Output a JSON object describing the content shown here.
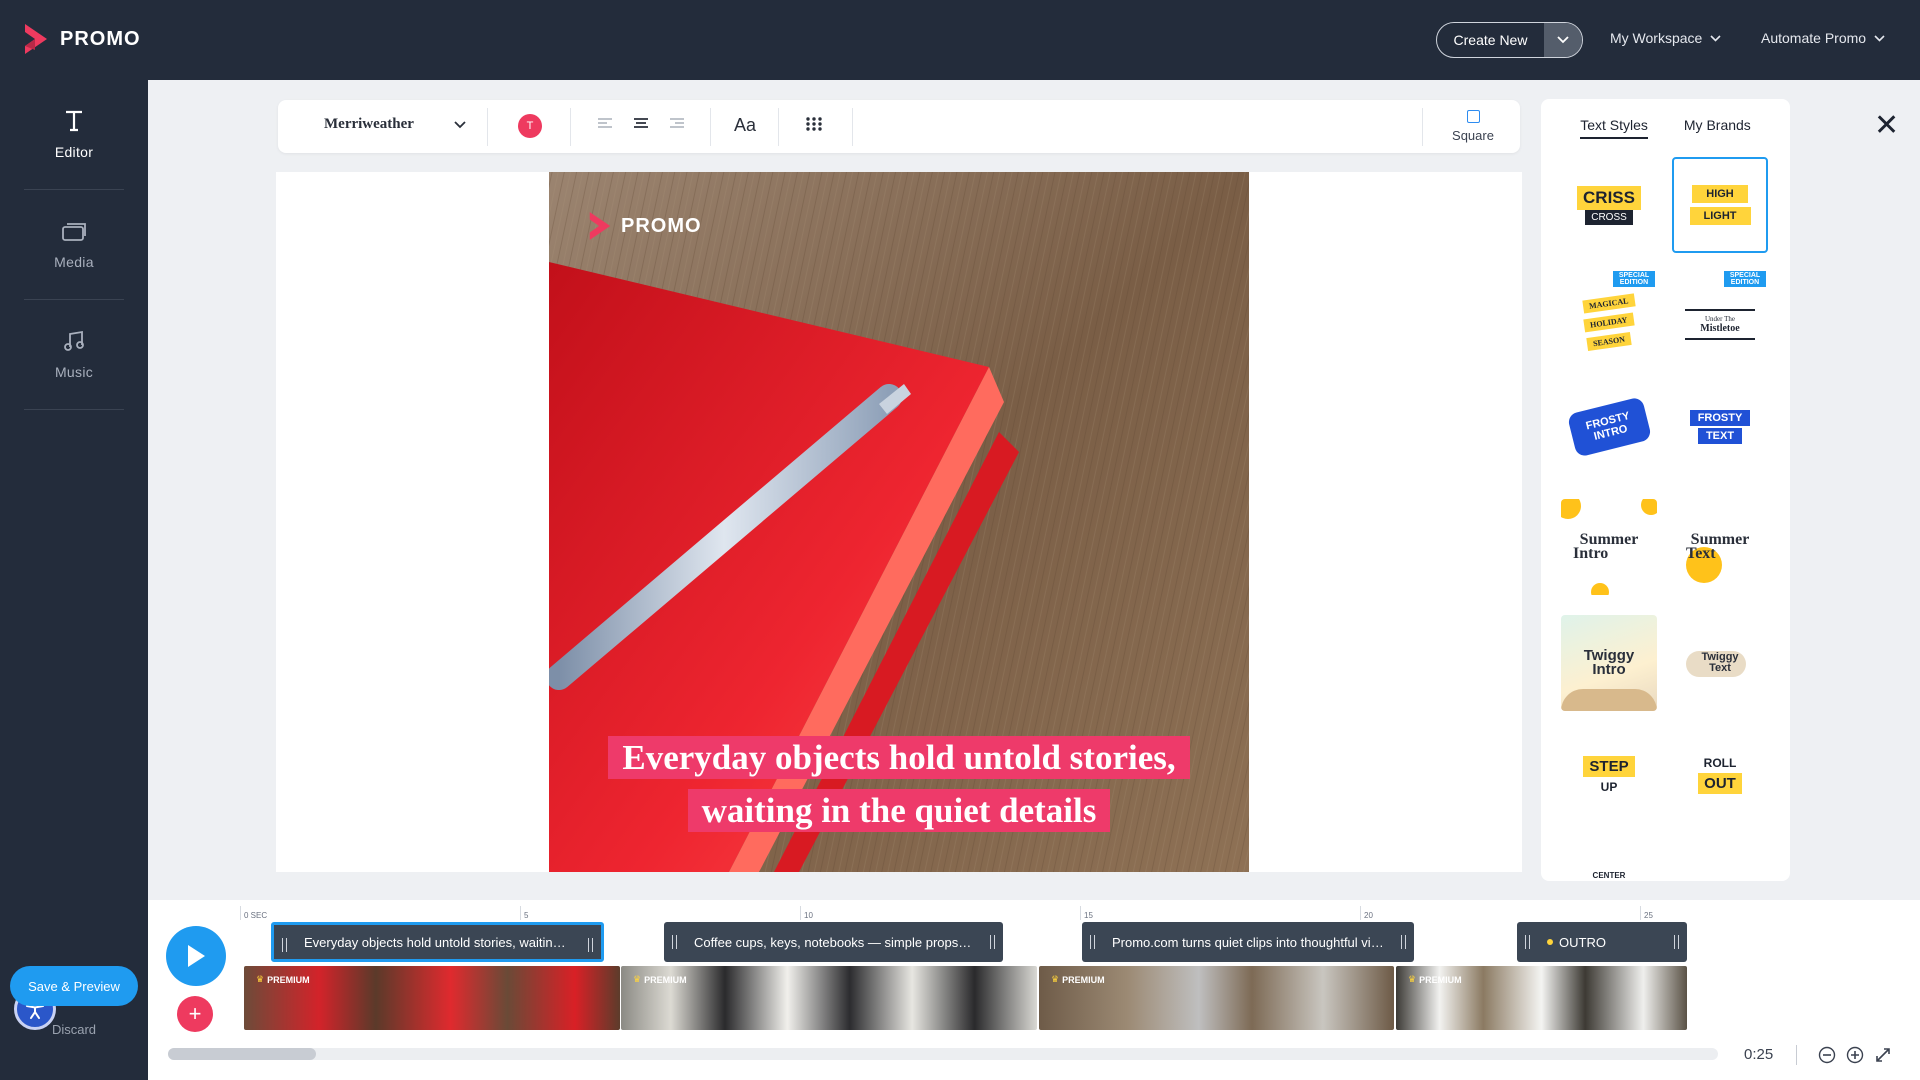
{
  "brand": {
    "name": "PROMO",
    "accent": "#ee3a5f",
    "blue": "#1f9bf0",
    "dark": "#232c3b"
  },
  "topbar": {
    "create_new": "Create New",
    "workspace": "My Workspace",
    "automate": "Automate Promo"
  },
  "sidebar": {
    "items": [
      {
        "label": "Editor",
        "icon": "text-t-icon"
      },
      {
        "label": "Media",
        "icon": "media-stack-icon"
      },
      {
        "label": "Music",
        "icon": "music-note-icon"
      }
    ],
    "save_label": "Save & Preview",
    "discard_label": "Discard"
  },
  "toolbar": {
    "font_name": "Merriweather",
    "color_letter": "T",
    "case_label": "Aa",
    "format_label": "Square"
  },
  "canvas": {
    "watermark": "PROMO",
    "caption_line1": "Everyday objects hold untold stories,",
    "caption_line2": "waiting in the quiet details"
  },
  "panel": {
    "tabs": [
      "Text Styles",
      "My Brands"
    ],
    "active_tab": "Text Styles",
    "styles": [
      {
        "line1": "CRISS",
        "line2": "CROSS"
      },
      {
        "line1": "HIGH",
        "line2": "LIGHT"
      },
      {
        "badge": "SPECIAL EDITION",
        "line1": "MAGICAL",
        "line2": "HOLIDAY",
        "line3": "SEASON"
      },
      {
        "badge": "SPECIAL EDITION",
        "line1": "Under The",
        "line2": "Mistletoe"
      },
      {
        "line1": "FROSTY",
        "line2": "INTRO"
      },
      {
        "line1": "FROSTY",
        "line2": "TEXT"
      },
      {
        "line1": "Summer",
        "line2": "Intro"
      },
      {
        "line1": "Summer",
        "line2": "Text"
      },
      {
        "line1": "Twiggy",
        "line2": "Intro"
      },
      {
        "line1": "Twiggy",
        "line2": "Text"
      },
      {
        "line1": "STEP",
        "line2": "UP"
      },
      {
        "line1": "ROLL",
        "line2": "OUT"
      }
    ],
    "partial_label": "CENTER"
  },
  "timeline": {
    "ticks": [
      "0 SEC",
      "5",
      "10",
      "15",
      "20",
      "25"
    ],
    "text_tracks": [
      "Everyday objects hold untold stories, waiting in the quiet details",
      "Coffee cups, keys, notebooks — simple props, powerful stories",
      "Promo.com turns quiet clips into thoughtful videos",
      "OUTRO"
    ],
    "premium_label": "PREMIUM",
    "duration": "0:25"
  }
}
